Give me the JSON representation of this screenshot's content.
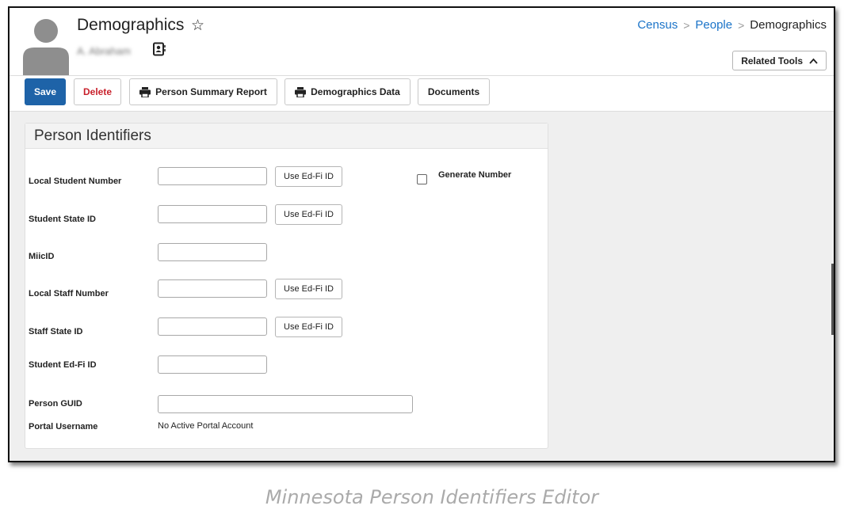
{
  "header": {
    "title": "Demographics",
    "person_name": "A. Abraham",
    "breadcrumb": [
      "Census",
      "People",
      "Demographics"
    ],
    "related_tools_label": "Related Tools"
  },
  "toolbar": {
    "save_label": "Save",
    "delete_label": "Delete",
    "person_summary_label": "Person Summary Report",
    "demographics_data_label": "Demographics Data",
    "documents_label": "Documents"
  },
  "panel": {
    "title": "Person Identifiers",
    "fields": [
      {
        "label": "Local Student Number",
        "value": "",
        "button": "Use Ed-Fi ID"
      },
      {
        "label": "Student State ID",
        "value": "",
        "button": "Use Ed-Fi ID"
      },
      {
        "label": "MiicID",
        "value": ""
      },
      {
        "label": "Local Staff Number",
        "value": "",
        "button": "Use Ed-Fi ID"
      },
      {
        "label": "Staff State ID",
        "value": "",
        "button": "Use Ed-Fi ID"
      },
      {
        "label": "Student Ed-Fi ID",
        "value": ""
      },
      {
        "label": "Person GUID",
        "value": ""
      }
    ],
    "generate_number_label": "Generate Number",
    "generate_number_checked": false,
    "portal_username_label": "Portal Username",
    "portal_username_value": "No Active Portal Account"
  },
  "caption": "Minnesota Person Identifiers Editor",
  "colors": {
    "primary": "#1e63a8",
    "delete": "#c8202b",
    "link": "#1a73c8"
  },
  "icons": [
    "star-icon",
    "contact-card-icon",
    "chevron-right-icon",
    "chevron-up-icon",
    "printer-icon",
    "checkbox-icon"
  ]
}
